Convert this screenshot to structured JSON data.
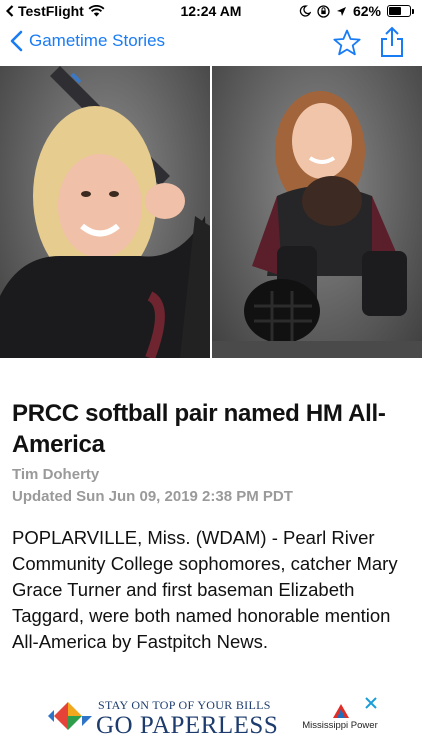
{
  "status_bar": {
    "back_app": "TestFlight",
    "time": "12:24 AM",
    "battery_percent": "62%",
    "battery_level": 0.62
  },
  "nav": {
    "back_label": "Gametime Stories",
    "accent_color": "#1a7cf5"
  },
  "article": {
    "headline": "PRCC softball pair named HM All-America",
    "author": "Tim Doherty",
    "updated": "Updated Sun Jun 09, 2019 2:38 PM PDT",
    "body": "POPLARVILLE, Miss. (WDAM) - Pearl River Community College sophomores, catcher Mary Grace Turner and first baseman Elizabeth Taggard, were both named honorable mention All-America by Fastpitch News."
  },
  "ad": {
    "tagline": "STAY ON TOP OF YOUR BILLS",
    "headline": "GO PAPERLESS",
    "brand": "Mississippi Power"
  },
  "icons": {
    "back": "chevron-left-icon",
    "star": "star-outline-icon",
    "share": "share-icon",
    "close": "close-icon"
  }
}
